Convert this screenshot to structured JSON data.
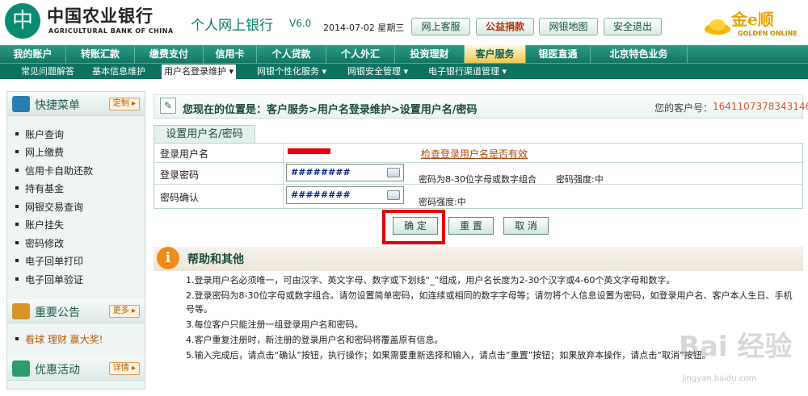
{
  "header": {
    "logo_glyph": "中",
    "bank_name_cn": "中国农业银行",
    "bank_name_en": "AGRICULTURAL BANK OF CHINA",
    "site_title": "个人网上银行",
    "version": "V6.0",
    "date": "2014-07-02 星期三",
    "buttons": {
      "service": "网上客服",
      "donate": "公益捐款",
      "map": "网银地图",
      "logout": "安全退出"
    },
    "partner_logo": "金e顺",
    "partner_logo_en": "GOLDEN ONLINE"
  },
  "main_nav": [
    "我的账户",
    "转账汇款",
    "缴费支付",
    "信用卡",
    "个人贷款",
    "个人外汇",
    "投资理财",
    "客户服务",
    "银医直通",
    "北京特色业务"
  ],
  "main_nav_active": "客户服务",
  "sub_nav": [
    "常见问题解答",
    "基本信息维护",
    "用户名登录维护 ▾",
    "网银个性化服务 ▾",
    "网银安全管理 ▾",
    "电子银行渠道管理 ▾"
  ],
  "sidebar": {
    "quick_menu_title": "快捷菜单",
    "quick_menu_button": "定制 ▸",
    "quick_links": [
      "账户查询",
      "网上缴费",
      "信用卡自助还款",
      "持有基金",
      "网银交易查询",
      "账户挂失",
      "密码修改",
      "电子回单打印",
      "电子回单验证"
    ],
    "notice_title": "重要公告",
    "notice_button": "更多 ▸",
    "notice_item": "看球  理财  赢大奖!",
    "offer_title": "优惠活动",
    "offer_button": "详情 ▸"
  },
  "breadcrumb": {
    "text": "您现在的位置是：客户服务>用户名登录维护>设置用户名/密码",
    "customer_label": "您的客户号：",
    "customer_no": "1641107378343146"
  },
  "form": {
    "tab": "设置用户名/密码",
    "username_label": "登录用户名",
    "check_link": "检查登录用户名是否有效",
    "password_label": "登录密码",
    "password_value": "########",
    "password_hint": "密码为8-30位字母或数字组合",
    "password_strength": "密码强度:中",
    "confirm_label": "密码确认",
    "confirm_value": "########",
    "confirm_strength": "密码强度:中"
  },
  "actions": {
    "ok": "确 定",
    "reset": "重 置",
    "cancel": "取 消"
  },
  "help": {
    "title": "帮助和其他",
    "items": [
      "1.登录用户名必须唯一，可由汉字、英文字母、数字或下划线“_”组成，用户名长度为2-30个汉字或4-60个英文字母和数字。",
      "2.登录密码为8-30位字母或数字组合。请勿设置简单密码，如连续或相同的数字字母等；请勿将个人信息设置为密码，如登录用户名、客户本人生日、手机号等。",
      "3.每位客户只能注册一组登录用户名和密码。",
      "4.客户重复注册时，新注册的登录用户名和密码将覆盖原有信息。",
      "5.输入完成后，请点击“确认”按钮，执行操作；如果需要重新选择和输入，请点击“重置”按钮；如果放弃本操作，请点击“取消”按钮。"
    ]
  },
  "watermark": {
    "text": "Bai 经验",
    "url": "jingyan.baidu.com"
  },
  "colors": {
    "brand": "#0a8a72",
    "nav": "#137664",
    "highlight": "#e3000b"
  }
}
